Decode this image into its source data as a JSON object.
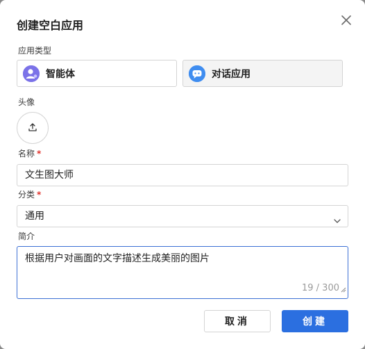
{
  "dialog": {
    "title": "创建空白应用",
    "close_icon": "close-icon"
  },
  "app_type": {
    "label": "应用类型",
    "options": [
      {
        "label": "智能体",
        "icon": "agent-icon",
        "selected": false
      },
      {
        "label": "对话应用",
        "icon": "chat-app-icon",
        "selected": true
      }
    ]
  },
  "avatar": {
    "label": "头像",
    "icon": "upload-icon"
  },
  "name": {
    "label": "名称",
    "required_mark": "*",
    "value": "文生图大师"
  },
  "category": {
    "label": "分类",
    "required_mark": "*",
    "value": "通用",
    "icon": "chevron-down-icon"
  },
  "description": {
    "label": "简介",
    "value": "根据用户对画面的文字描述生成美丽的图片",
    "counter": "19 / 300"
  },
  "buttons": {
    "cancel": "取消",
    "create": "创建"
  },
  "colors": {
    "primary": "#2b6fe0",
    "required": "#e0302a",
    "focus_border": "#3b6fd4"
  }
}
